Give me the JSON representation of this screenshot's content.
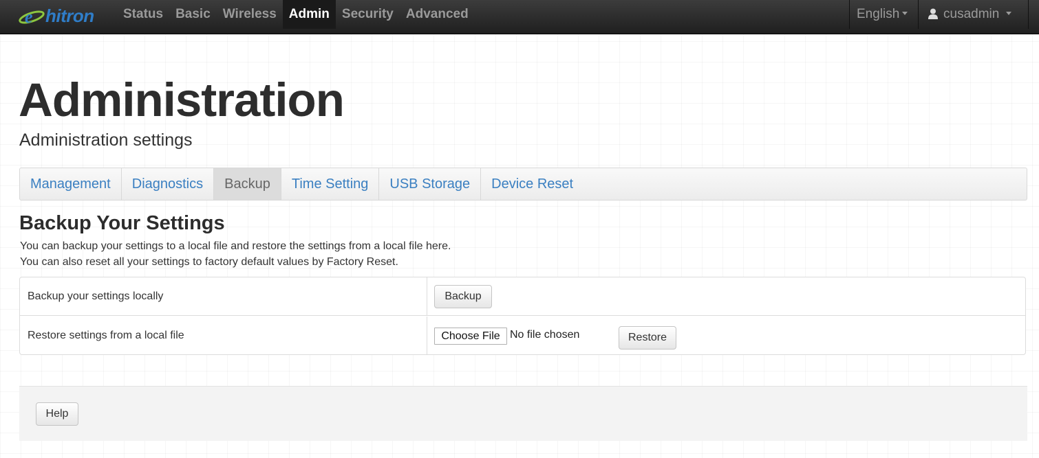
{
  "brand": {
    "name": "hitron"
  },
  "nav": {
    "links": [
      "Status",
      "Basic",
      "Wireless",
      "Admin",
      "Security",
      "Advanced"
    ],
    "active": "Admin",
    "language": "English",
    "user": "cusadmin"
  },
  "page": {
    "title": "Administration",
    "subtitle": "Administration settings"
  },
  "tabs": {
    "items": [
      "Management",
      "Diagnostics",
      "Backup",
      "Time Setting",
      "USB Storage",
      "Device Reset"
    ],
    "active": "Backup"
  },
  "section": {
    "title": "Backup Your Settings",
    "desc_line1": "You can backup your settings to a local file and restore the settings from a local file here.",
    "desc_line2": "You can also reset all your settings to factory default values by Factory Reset."
  },
  "settings": {
    "backup_label": "Backup your settings locally",
    "backup_button": "Backup",
    "restore_label": "Restore settings from a local file",
    "choose_file_button": "Choose File",
    "file_status": "No file chosen",
    "restore_button": "Restore"
  },
  "footer": {
    "help_button": "Help"
  },
  "colors": {
    "navbar": "#2a2a2a",
    "link": "#3a7fc1",
    "brand": "#2f7dc8",
    "brand_swoosh": "#8cc63f"
  }
}
